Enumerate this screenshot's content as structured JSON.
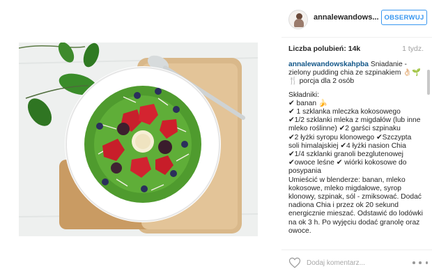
{
  "post": {
    "username": "annalewandows...",
    "follow_label": "OBSERWUJ",
    "likes": "Liczba polubień: 14k",
    "time": "1 tydz.",
    "caption": {
      "author": "annalewandowskahpba",
      "intro": "Śniadanie - zielony pudding chia ze szpinakiem 👌🏻🌱 🍴 porcja dla 2 osób",
      "ingredients_header": "Składniki:",
      "ingredients": [
        "✔ banan 🍌",
        "✔ 1 szklanka mleczka kokosowego",
        "✔1/2 szklanki mleka z migdałów (lub inne mleko roślinne) ✔2 garści szpinaku",
        "✔2 łyżki syropu klonowego ✔Szczypta soli himalajskiej ✔4 łyżki nasion Chia",
        "✔1/4 szklanki granoli bezglutenowej ✔owoce leśne ✔ wiórki kokosowe do posypania"
      ],
      "instructions": "Umieścić w blenderze: banan, mleko kokosowe, mleko migdałowe, syrop klonowy, szpinak, sól - zmiksować. Dodać nadiona Chia i przez ok 20 sekund energicznie mieszać. Odstawić do lodówki na ok 3 h. Po wyjęciu dodać granolę oraz owoce."
    },
    "comment_placeholder": "Dodaj komentarz...",
    "icons": {
      "avatar": "profile-avatar",
      "like": "heart-outline-icon",
      "more": "more-options-icon"
    },
    "colors": {
      "accent": "#3897f0",
      "author": "#125688",
      "muted": "#a0a0a0"
    }
  }
}
